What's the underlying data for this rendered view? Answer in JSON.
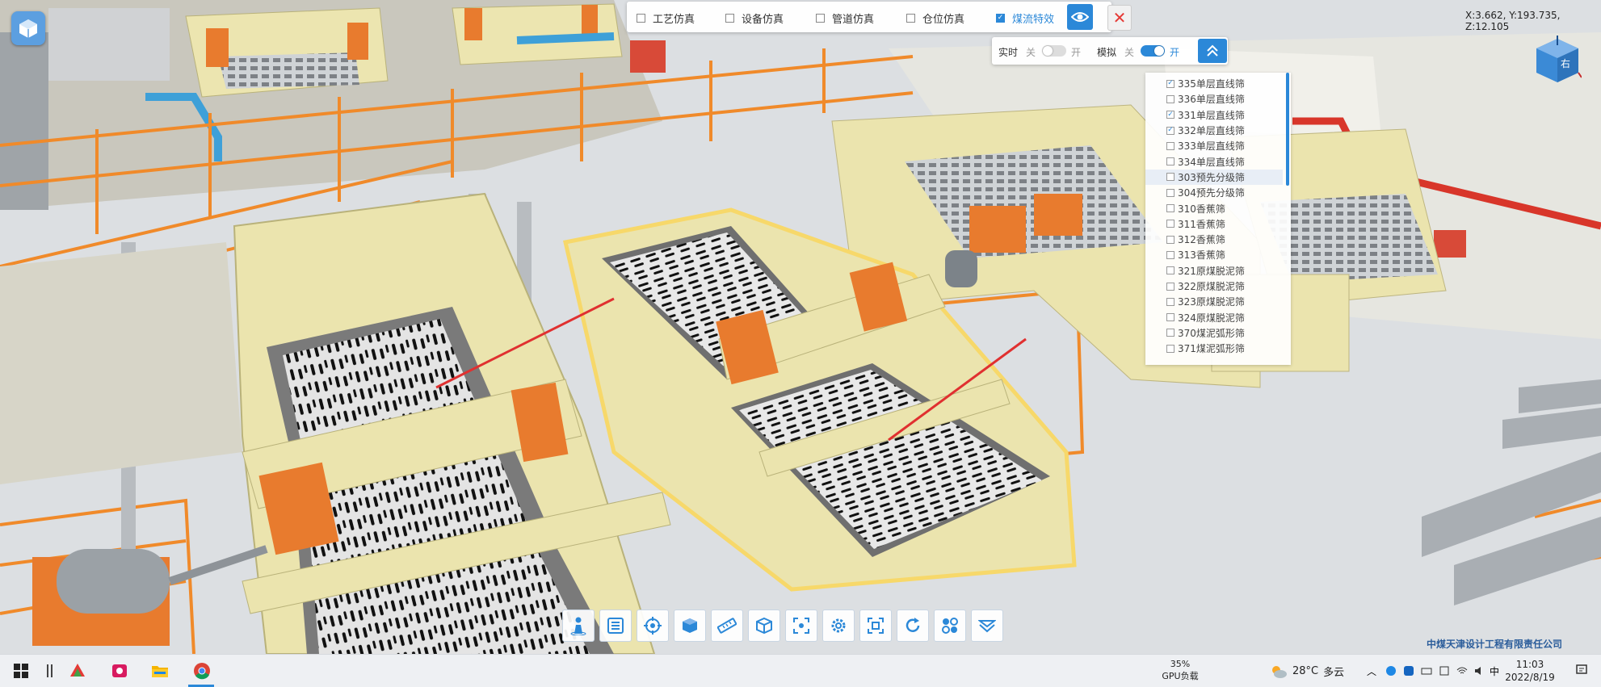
{
  "sim_toolbar": {
    "options": [
      {
        "label": "工艺仿真",
        "checked": false
      },
      {
        "label": "设备仿真",
        "checked": false
      },
      {
        "label": "管道仿真",
        "checked": false
      },
      {
        "label": "仓位仿真",
        "checked": false
      },
      {
        "label": "煤流特效",
        "checked": true
      }
    ],
    "eye_icon": "eye-icon",
    "close_icon": "close-icon"
  },
  "toggles": {
    "realtime": {
      "label": "实时",
      "off": "关",
      "on": "开",
      "enabled": false
    },
    "simulate": {
      "label": "模拟",
      "off": "关",
      "on": "开",
      "enabled": true
    }
  },
  "equipment_list": [
    {
      "label": "335单层直线筛",
      "checked": true
    },
    {
      "label": "336单层直线筛",
      "checked": false
    },
    {
      "label": "331单层直线筛",
      "checked": true
    },
    {
      "label": "332单层直线筛",
      "checked": true
    },
    {
      "label": "333单层直线筛",
      "checked": false
    },
    {
      "label": "334单层直线筛",
      "checked": false
    },
    {
      "label": "303预先分级筛",
      "checked": false,
      "highlighted": true
    },
    {
      "label": "304预先分级筛",
      "checked": false
    },
    {
      "label": "310香蕉筛",
      "checked": false
    },
    {
      "label": "311香蕉筛",
      "checked": false
    },
    {
      "label": "312香蕉筛",
      "checked": false
    },
    {
      "label": "313香蕉筛",
      "checked": false
    },
    {
      "label": "321原煤脱泥筛",
      "checked": false
    },
    {
      "label": "322原煤脱泥筛",
      "checked": false
    },
    {
      "label": "323原煤脱泥筛",
      "checked": false
    },
    {
      "label": "324原煤脱泥筛",
      "checked": false
    },
    {
      "label": "370煤泥弧形筛",
      "checked": false
    },
    {
      "label": "371煤泥弧形筛",
      "checked": false
    }
  ],
  "coords": "X:3.662, Y:193.735, Z:12.105",
  "nav_cube_label": "右",
  "bottom_tools": [
    "person-icon",
    "list-icon",
    "target-icon",
    "cube-icon",
    "ruler-icon",
    "box-icon",
    "focus-icon",
    "gear-icon",
    "fit-icon",
    "refresh-icon",
    "pipe-icon",
    "layers-icon"
  ],
  "company": "中煤天津设计工程有限责任公司",
  "taskbar": {
    "gpu_percent": "35%",
    "gpu_label": "GPU负载",
    "temperature": "28°C",
    "weather": "多云",
    "time": "11:03",
    "date": "2022/8/19"
  },
  "colors": {
    "accent": "#2b88d8",
    "close": "#e53935",
    "machine": "#ece6b0",
    "orange": "#e87b2e"
  }
}
